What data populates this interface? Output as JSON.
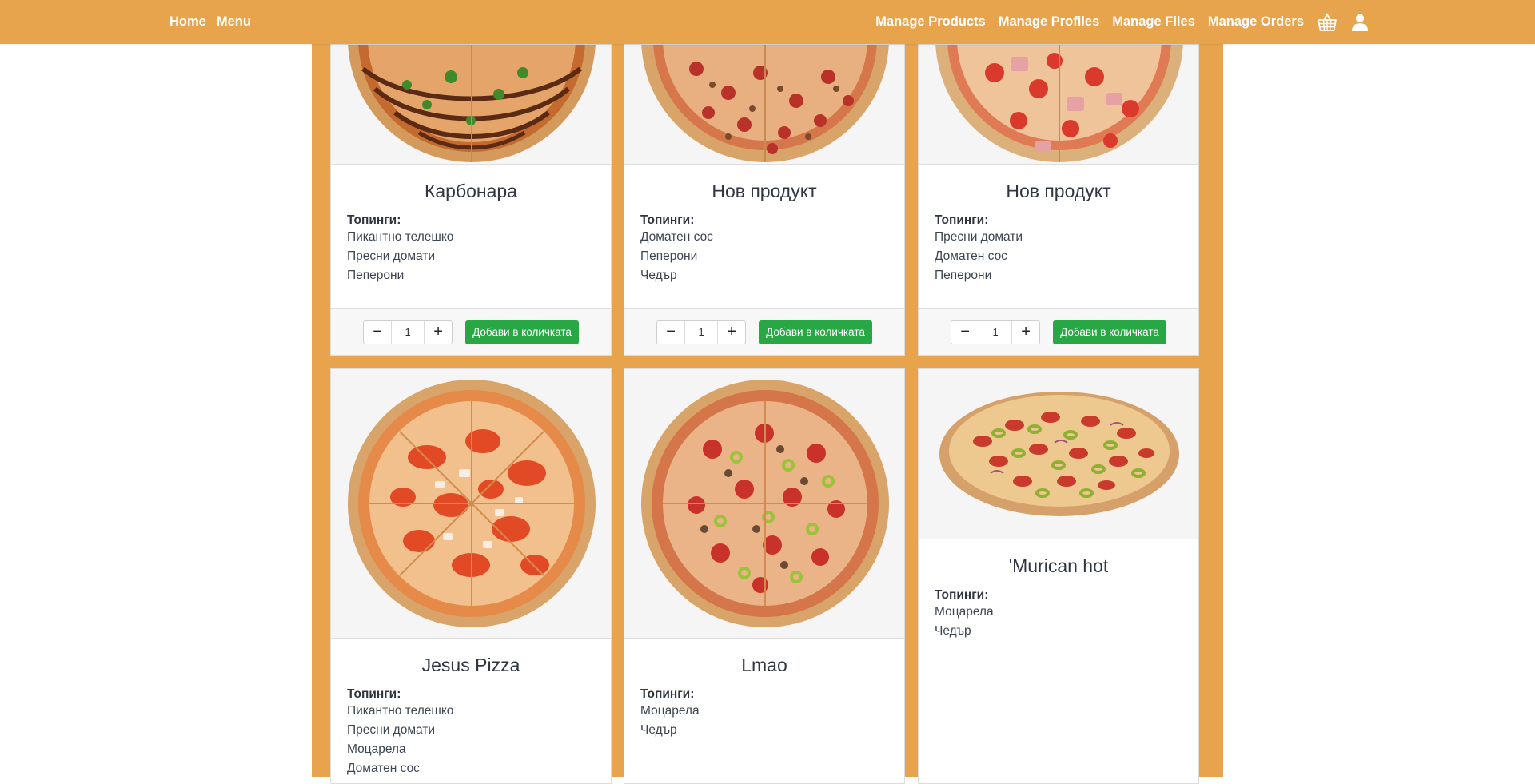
{
  "navbar": {
    "left_links": [
      "Home",
      "Menu"
    ],
    "right_links": [
      "Manage Products",
      "Manage Profiles",
      "Manage Files",
      "Manage Orders"
    ],
    "cart_icon": "basket-icon",
    "user_icon": "user-icon",
    "accent_color": "#e8a44c"
  },
  "products": [
    {
      "title": "Карбонара",
      "toppings_label": "Топинги:",
      "toppings": [
        "Пикантно телешко",
        "Пресни домати",
        "Пеперони"
      ],
      "quantity": "1",
      "add_label": "Добави в количката"
    },
    {
      "title": "Нов продукт",
      "toppings_label": "Топинги:",
      "toppings": [
        "Доматен сос",
        "Пеперони",
        "Чедър"
      ],
      "quantity": "1",
      "add_label": "Добави в количката"
    },
    {
      "title": "Нов продукт",
      "toppings_label": "Топинги:",
      "toppings": [
        "Пресни домати",
        "Доматен сос",
        "Пеперони"
      ],
      "quantity": "1",
      "add_label": "Добави в количката"
    },
    {
      "title": "Jesus Pizza",
      "toppings_label": "Топинги:",
      "toppings": [
        "Пикантно телешко",
        "Пресни домати",
        "Моцарела",
        "Доматен сос"
      ]
    },
    {
      "title": "Lmao",
      "toppings_label": "Топинги:",
      "toppings": [
        "Моцарела",
        "Чедър"
      ]
    },
    {
      "title": "'Murican hot",
      "toppings_label": "Топинги:",
      "toppings": [
        "Моцарела",
        "Чедър"
      ]
    }
  ],
  "colors": {
    "button_green": "#28a745",
    "container_orange": "#e8a44c"
  }
}
